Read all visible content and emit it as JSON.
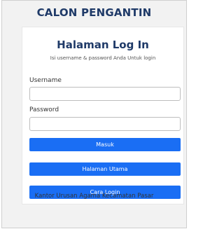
{
  "header": {
    "app_title": "CALON PENGANTIN"
  },
  "login": {
    "title": "Halaman Log In",
    "subtitle": "Isi username & password Anda Untuk login",
    "username_label": "Username",
    "username_value": "",
    "password_label": "Password",
    "password_value": ""
  },
  "buttons": {
    "submit_label": "Masuk",
    "home_label": "Halaman Utama",
    "howto_label": "Cara Login"
  },
  "footer": {
    "text": "Kantor Urusan Agama Kecamatan Pasar"
  },
  "colors": {
    "title": "#1f3a68",
    "button": "#1a6ef4",
    "page_background": "#f2f2f2"
  }
}
